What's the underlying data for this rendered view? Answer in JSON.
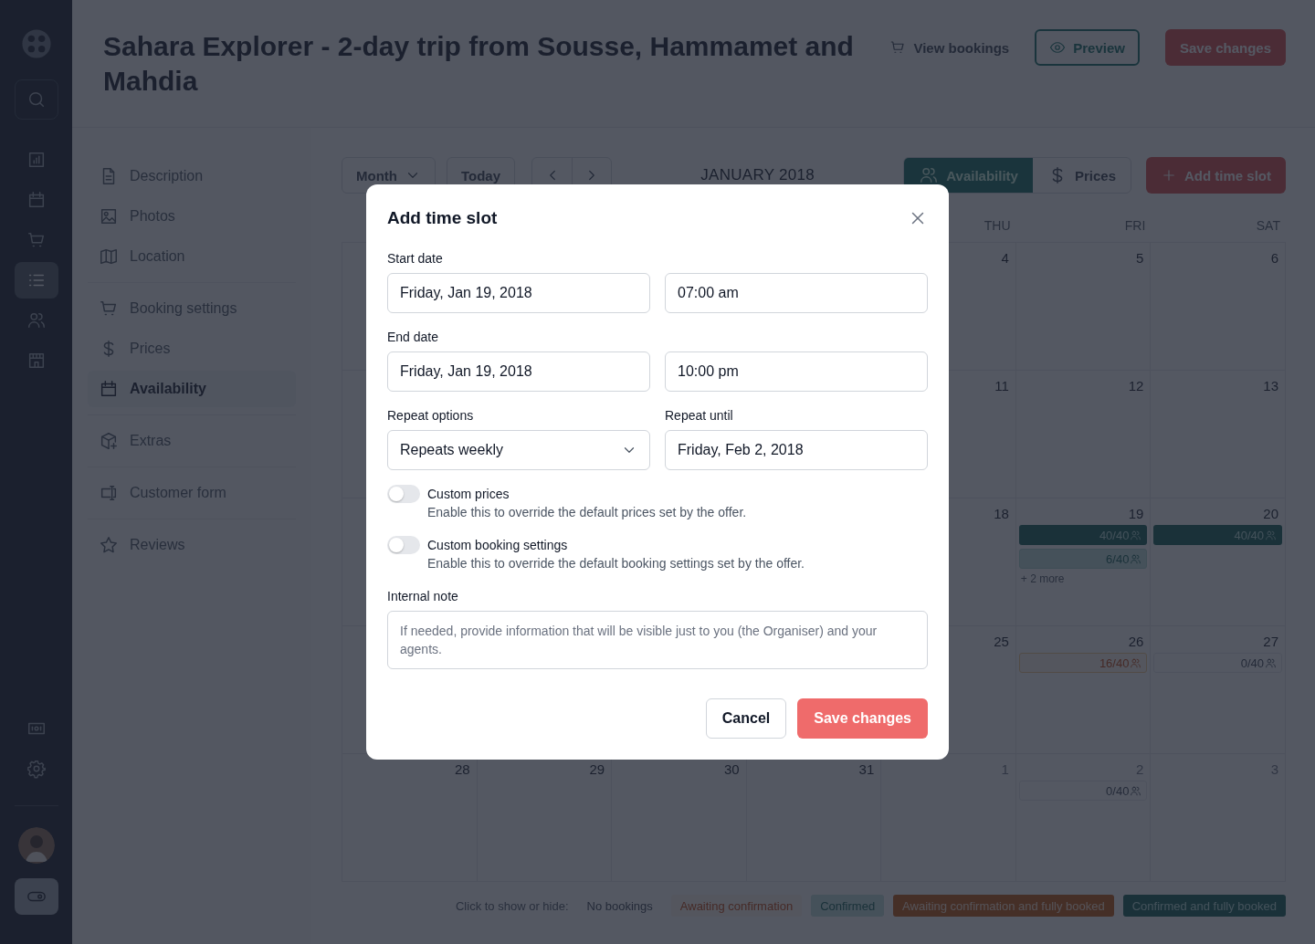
{
  "rail": {
    "items": [
      {
        "selected": false
      },
      {
        "selected": false
      },
      {
        "selected": false
      },
      {
        "selected": true
      },
      {
        "selected": false
      },
      {
        "selected": false
      }
    ],
    "bottom": [
      {
        "selected": false
      },
      {
        "selected": false
      }
    ]
  },
  "header": {
    "title": "Sahara Explorer - 2-day trip from Sousse, Hammamet and Mahdia",
    "view_bookings": "View bookings",
    "preview": "Preview",
    "save": "Save changes"
  },
  "nav": {
    "groups": [
      {
        "items": [
          {
            "label": "Description",
            "selected": false
          },
          {
            "label": "Photos",
            "selected": false
          },
          {
            "label": "Location",
            "selected": false
          }
        ]
      },
      {
        "items": [
          {
            "label": "Booking settings",
            "selected": false
          },
          {
            "label": "Prices",
            "selected": false
          },
          {
            "label": "Availability",
            "selected": true
          }
        ]
      },
      {
        "items": [
          {
            "label": "Extras",
            "selected": false
          }
        ]
      },
      {
        "items": [
          {
            "label": "Customer form",
            "selected": false
          }
        ]
      },
      {
        "items": [
          {
            "label": "Reviews",
            "selected": false
          }
        ]
      }
    ]
  },
  "toolbar": {
    "view": "Month",
    "today": "Today",
    "title": "JANUARY 2018",
    "modes": [
      {
        "label": "Availability",
        "selected": true
      },
      {
        "label": "Prices",
        "selected": false
      }
    ],
    "add": "Add time slot"
  },
  "calendar": {
    "weekdays": [
      "THU",
      "FRI",
      "SAT"
    ],
    "weeks": [
      {
        "days": [
          {
            "day": "4"
          },
          {
            "day": "5"
          },
          {
            "day": "6"
          }
        ]
      },
      {
        "days": [
          {
            "day": "11"
          },
          {
            "day": "12"
          },
          {
            "day": "13"
          }
        ]
      },
      {
        "days": [
          {
            "day": "18"
          },
          {
            "day": "19",
            "slots": [
              {
                "label": "40/40",
                "kind": "confirmed_full"
              },
              {
                "label": "6/40",
                "kind": "confirmed"
              }
            ],
            "more": "+ 2 more"
          },
          {
            "day": "20",
            "slots": [
              {
                "label": "40/40",
                "kind": "confirmed_full"
              }
            ]
          }
        ]
      },
      {
        "days": [
          {
            "day": "25"
          },
          {
            "day": "26",
            "slots": [
              {
                "label": "16/40",
                "kind": "awaiting"
              }
            ]
          },
          {
            "day": "27",
            "slots": [
              {
                "label": "0/40",
                "kind": "no_bookings"
              }
            ]
          }
        ]
      },
      {
        "days": [
          {
            "day": "28"
          },
          {
            "day": "29"
          },
          {
            "day": "30"
          },
          {
            "day": "31"
          },
          {
            "day": "1",
            "muted": true
          },
          {
            "day": "2",
            "muted": true,
            "slots": [
              {
                "label": "0/40",
                "kind": "no_bookings"
              }
            ]
          },
          {
            "day": "3",
            "muted": true
          }
        ]
      }
    ]
  },
  "legend": {
    "label": "Click to show or hide:",
    "items": [
      {
        "label": "No bookings",
        "kind": "no_bookings"
      },
      {
        "label": "Awaiting confirmation",
        "kind": "awaiting"
      },
      {
        "label": "Confirmed",
        "kind": "confirmed"
      },
      {
        "label": "Awaiting confirmation and fully booked",
        "kind": "awaiting_full"
      },
      {
        "label": "Confirmed and fully booked",
        "kind": "confirmed_full"
      }
    ]
  },
  "modal": {
    "title": "Add time slot",
    "start_label": "Start date",
    "start_date": "Friday, Jan 19, 2018",
    "start_time": "07:00 am",
    "end_label": "End date",
    "end_date": "Friday, Jan 19, 2018",
    "end_time": "10:00 pm",
    "repeat_label": "Repeat options",
    "repeat_value": "Repeats weekly",
    "until_label": "Repeat until",
    "until_value": "Friday, Feb 2, 2018",
    "toggles": [
      {
        "label": "Custom prices",
        "hint": "Enable this to override the default prices set by the offer.",
        "on": false
      },
      {
        "label": "Custom booking settings",
        "hint": "Enable this to override the default booking settings set by the offer.",
        "on": false
      }
    ],
    "note_label": "Internal note",
    "note_placeholder": "If needed, provide information that will be visible just to you (the Organiser) and your agents.",
    "cancel": "Cancel",
    "save": "Save changes"
  }
}
